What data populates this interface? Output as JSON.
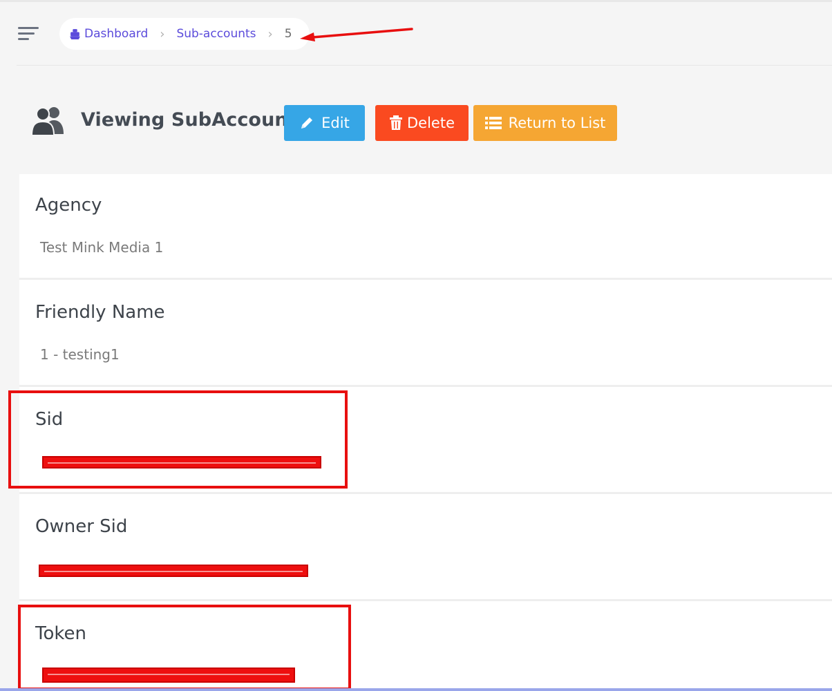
{
  "breadcrumb": {
    "home_icon": "dashboard-home-icon",
    "items": [
      "Dashboard",
      "Sub-accounts"
    ],
    "current": "5",
    "separator": "›"
  },
  "header": {
    "title": "Viewing SubAccount",
    "icon": "users-icon",
    "buttons": {
      "edit": "Edit",
      "delete": "Delete",
      "return": "Return to List"
    }
  },
  "fields": [
    {
      "label": "Agency",
      "value": "Test Mink Media 1"
    },
    {
      "label": "Friendly Name",
      "value": "1 - testing1"
    },
    {
      "label": "Sid",
      "value": "",
      "redacted": true
    },
    {
      "label": "Owner Sid",
      "value": "",
      "redacted": true
    },
    {
      "label": "Token",
      "value": "",
      "redacted": true
    }
  ],
  "colors": {
    "edit": "#36a6e6",
    "delete": "#fa4a20",
    "return": "#f5a633",
    "link": "#5b4bdb",
    "annotation": "#e80f0f"
  }
}
